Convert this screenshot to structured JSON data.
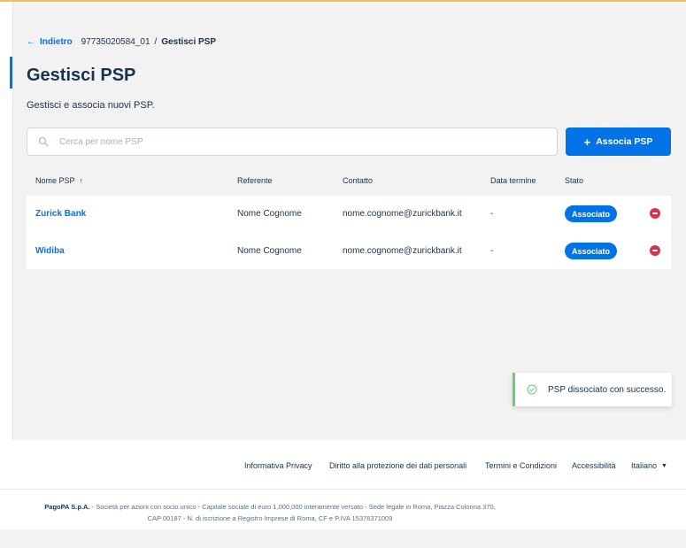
{
  "breadcrumb": {
    "back_label": "Indietro",
    "id": "97735020584_01",
    "separator": "/",
    "current": "Gestisci PSP"
  },
  "page": {
    "title": "Gestisci PSP",
    "subtitle": "Gestisci e associa nuovi PSP."
  },
  "search": {
    "placeholder": "Cerca per nome PSP",
    "icon": "search-icon"
  },
  "add_button": {
    "label": "Associa PSP",
    "icon": "plus-icon"
  },
  "table": {
    "columns": [
      "Nome PSP",
      "Referente",
      "Contatto",
      "Data termine",
      "Stato"
    ],
    "sort_indicator": "↑",
    "rows": [
      {
        "name": "Zurick Bank",
        "referent": "Nome Cognome",
        "contact": "nome.cognome@zurickbank.it",
        "end_date": "-",
        "status": "Associato"
      },
      {
        "name": "Widiba",
        "referent": "Nome Cognome",
        "contact": "nome.cognome@zurickbank.it",
        "end_date": "-",
        "status": "Associato"
      }
    ]
  },
  "toast": {
    "message": "PSP dissociato con successo.",
    "icon": "check-circle-icon"
  },
  "footer": {
    "links": [
      "Informativa Privacy",
      "Diritto alla protezione dei dati personali",
      "Termini e Condizioni",
      "Accessibilità"
    ],
    "language": "Italiano",
    "legal_brand": "PagoPA S.p.A.",
    "legal_line1": " - Società per azioni con socio unico - Capitale sociale di euro 1,000,000 interamente versato - Sede legale in Roma, Piazza Colonna 370,",
    "legal_line2": "CAP 00187 - N. di iscrizione a Registro Imprese di Roma, CF e P.IVA 15376371009"
  },
  "colors": {
    "primary": "#0073e6",
    "text": "#17324d",
    "danger": "#d1344c",
    "success": "#6ccd6c",
    "top_accent": "#f5bd5f"
  }
}
